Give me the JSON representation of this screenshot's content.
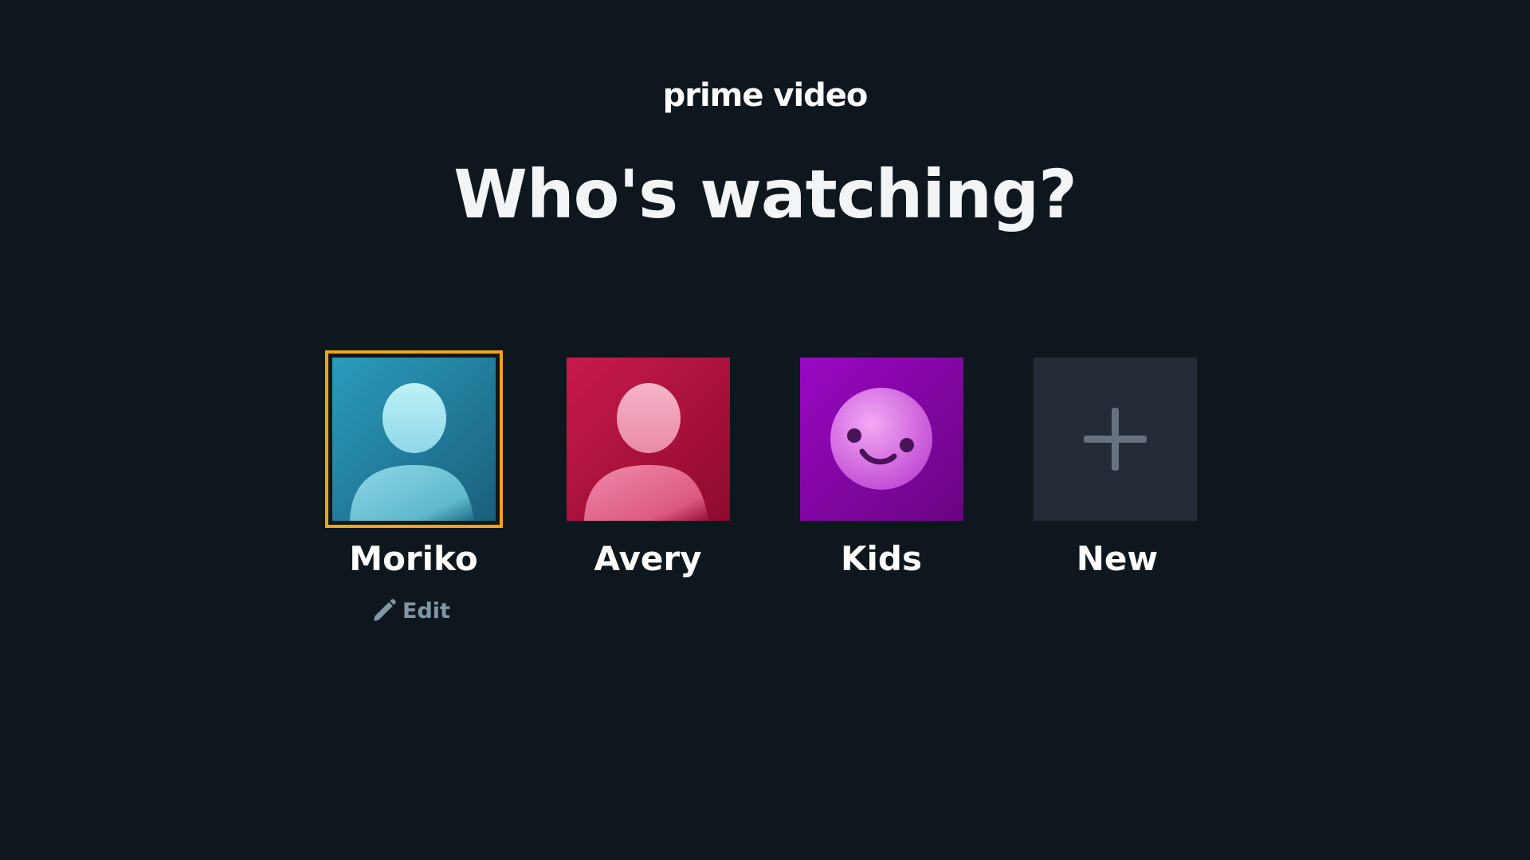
{
  "brand": {
    "logo_text": "prime video"
  },
  "heading": "Who's watching?",
  "profiles": [
    {
      "name": "Moriko",
      "avatar_icon": "person-icon",
      "color_top": "#2a9cbc",
      "color_bottom": "#1a5f7c",
      "selected": true
    },
    {
      "name": "Avery",
      "avatar_icon": "person-icon",
      "color_top": "#c81a4c",
      "color_bottom": "#8e0a2e",
      "selected": false
    },
    {
      "name": "Kids",
      "avatar_icon": "smiley-face-icon",
      "color_top": "#9a08c4",
      "color_bottom": "#6a0482",
      "selected": false
    },
    {
      "name": "New",
      "avatar_icon": "plus-icon",
      "color_top": "#232f3e",
      "color_bottom": "#232f3e",
      "selected": false
    }
  ],
  "edit": {
    "label": "Edit",
    "icon": "pencil-icon"
  },
  "colors": {
    "background": "#0f171e",
    "focus_outline": "#f5a31c",
    "edit_text": "#8197a4"
  }
}
